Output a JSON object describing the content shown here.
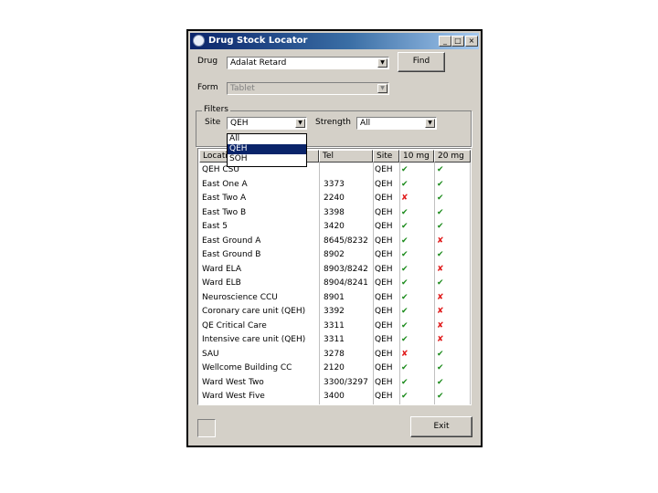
{
  "window": {
    "title": "Drug Stock Locator",
    "controls": {
      "minimize": "_",
      "maximize": "□",
      "close": "×"
    }
  },
  "drug": {
    "label": "Drug",
    "value": "Adalat Retard",
    "find_label": "Find"
  },
  "form": {
    "label": "Form",
    "value": "Tablet"
  },
  "filters": {
    "legend": "Filters",
    "site_label": "Site",
    "site_value": "QEH",
    "strength_label": "Strength",
    "strength_value": "All",
    "site_options": [
      "All",
      "QEH",
      "SOH"
    ],
    "site_selected_index": 1
  },
  "table": {
    "columns": [
      "Location",
      "Tel",
      "Site",
      "10 mg",
      "20 mg"
    ],
    "rows": [
      {
        "location": "QEH CSU",
        "tel": "",
        "site": "QEH",
        "mg10": "ok",
        "mg20": "ok"
      },
      {
        "location": "East One A",
        "tel": "3373",
        "site": "QEH",
        "mg10": "ok",
        "mg20": "ok"
      },
      {
        "location": "East Two A",
        "tel": "2240",
        "site": "QEH",
        "mg10": "no",
        "mg20": "ok"
      },
      {
        "location": "East Two B",
        "tel": "3398",
        "site": "QEH",
        "mg10": "ok",
        "mg20": "ok"
      },
      {
        "location": "East 5",
        "tel": "3420",
        "site": "QEH",
        "mg10": "ok",
        "mg20": "ok"
      },
      {
        "location": "East Ground A",
        "tel": "8645/8232",
        "site": "QEH",
        "mg10": "ok",
        "mg20": "no"
      },
      {
        "location": "East Ground B",
        "tel": "8902",
        "site": "QEH",
        "mg10": "ok",
        "mg20": "ok"
      },
      {
        "location": "Ward ELA",
        "tel": "8903/8242",
        "site": "QEH",
        "mg10": "ok",
        "mg20": "no"
      },
      {
        "location": "Ward ELB",
        "tel": "8904/8241",
        "site": "QEH",
        "mg10": "ok",
        "mg20": "ok"
      },
      {
        "location": "Neuroscience CCU",
        "tel": "8901",
        "site": "QEH",
        "mg10": "ok",
        "mg20": "no"
      },
      {
        "location": "Coronary care unit (QEH)",
        "tel": "3392",
        "site": "QEH",
        "mg10": "ok",
        "mg20": "no"
      },
      {
        "location": "QE Critical Care",
        "tel": "3311",
        "site": "QEH",
        "mg10": "ok",
        "mg20": "no"
      },
      {
        "location": "Intensive care unit (QEH)",
        "tel": "3311",
        "site": "QEH",
        "mg10": "ok",
        "mg20": "no"
      },
      {
        "location": "SAU",
        "tel": "3278",
        "site": "QEH",
        "mg10": "no",
        "mg20": "ok"
      },
      {
        "location": "Wellcome Building CC",
        "tel": "2120",
        "site": "QEH",
        "mg10": "ok",
        "mg20": "ok"
      },
      {
        "location": "Ward West Two",
        "tel": "3300/3297",
        "site": "QEH",
        "mg10": "ok",
        "mg20": "ok"
      },
      {
        "location": "Ward West Five",
        "tel": "3400",
        "site": "QEH",
        "mg10": "ok",
        "mg20": "ok"
      }
    ],
    "icons": {
      "ok": "✔",
      "no": "✘"
    }
  },
  "footer": {
    "exit_label": "Exit"
  },
  "colors": {
    "titlebar": "#0a246a",
    "selection": "#0a246a",
    "ok": "#1a8a1a",
    "no": "#e01b1b",
    "face": "#d4d0c8"
  }
}
